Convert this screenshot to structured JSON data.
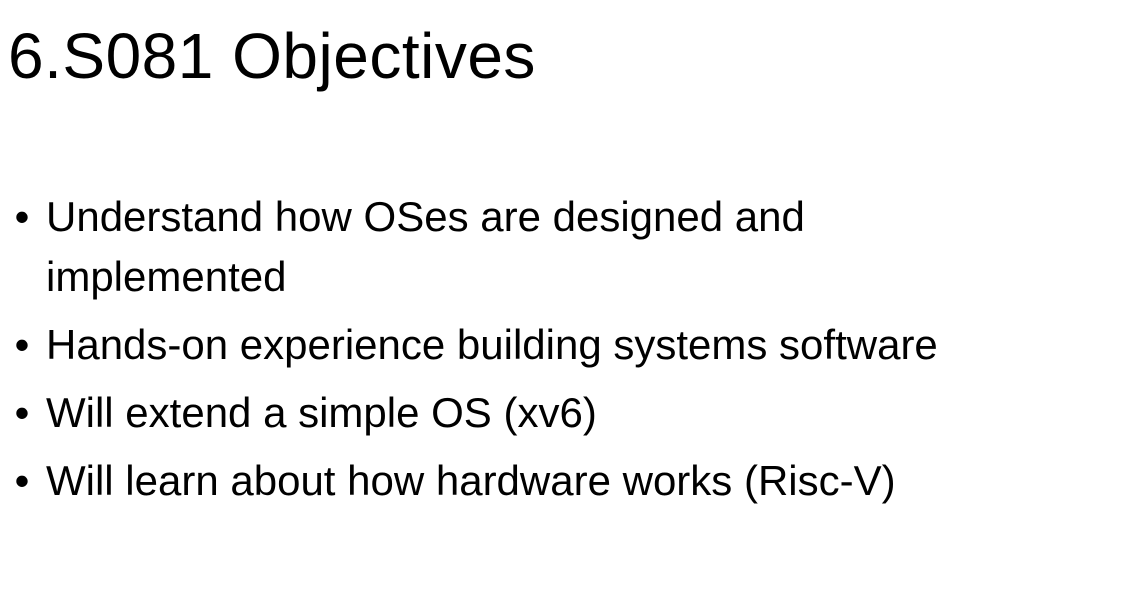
{
  "slide": {
    "title": "6.S081 Objectives",
    "bullet_glyph": "•",
    "bullets": [
      "Understand how OSes are designed and implemented",
      "Hands-on experience building systems software",
      "Will extend a simple OS (xv6)",
      "Will learn about how hardware works (Risc-V)"
    ]
  }
}
